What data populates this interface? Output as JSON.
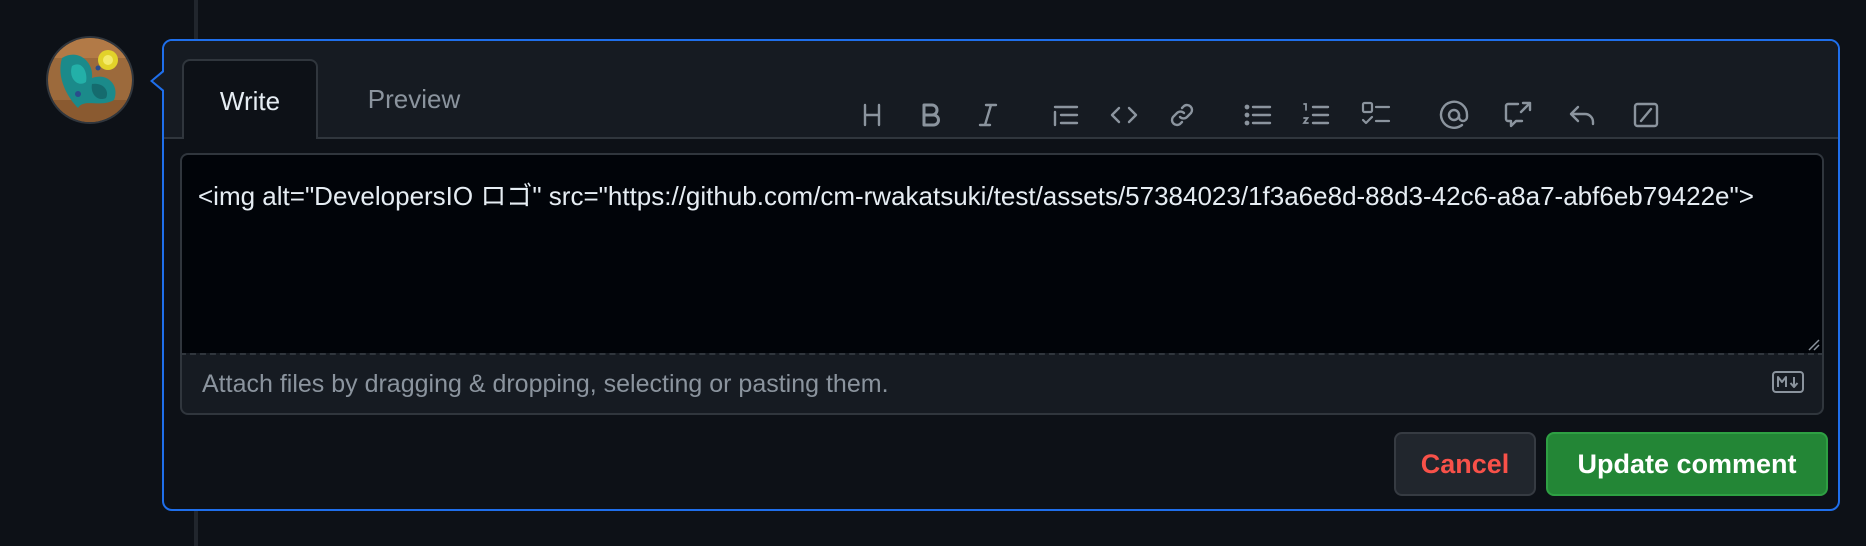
{
  "tabs": {
    "write": "Write",
    "preview": "Preview"
  },
  "toolbar": [
    {
      "name": "heading-icon"
    },
    {
      "name": "bold-icon"
    },
    {
      "name": "italic-icon"
    },
    {
      "name": "quote-icon"
    },
    {
      "name": "code-icon"
    },
    {
      "name": "link-icon"
    },
    {
      "name": "unordered-list-icon"
    },
    {
      "name": "ordered-list-icon"
    },
    {
      "name": "task-list-icon"
    },
    {
      "name": "mention-icon"
    },
    {
      "name": "cross-reference-icon"
    },
    {
      "name": "saved-reply-icon"
    },
    {
      "name": "slash-command-icon"
    }
  ],
  "editor": {
    "value": "<img alt=\"DevelopersIO ロゴ\" src=\"https://github.com/cm-rwakatsuki/test/assets/57384023/1f3a6e8d-88d3-42c6-a8a7-abf6eb79422e\">"
  },
  "attach": {
    "text": "Attach files by dragging & dropping, selecting or pasting them.",
    "markdown_badge": "markdown-icon"
  },
  "buttons": {
    "cancel": "Cancel",
    "update": "Update comment"
  },
  "colors": {
    "accent_border": "#1f6feb",
    "cancel_text": "#f85149",
    "update_bg": "#238636",
    "background": "#0d1117"
  }
}
